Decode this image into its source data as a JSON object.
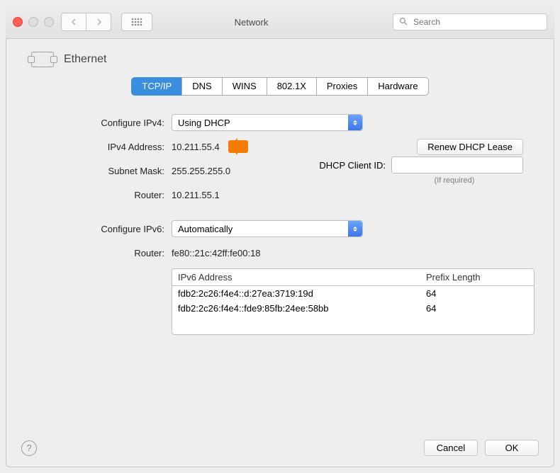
{
  "window": {
    "title": "Network"
  },
  "toolbar": {
    "search_placeholder": "Search"
  },
  "header": {
    "interface": "Ethernet"
  },
  "tabs": [
    "TCP/IP",
    "DNS",
    "WINS",
    "802.1X",
    "Proxies",
    "Hardware"
  ],
  "active_tab_index": 0,
  "ipv4": {
    "configure_label": "Configure IPv4:",
    "configure_value": "Using DHCP",
    "addr_label": "IPv4 Address:",
    "addr_value": "10.211.55.4",
    "mask_label": "Subnet Mask:",
    "mask_value": "255.255.255.0",
    "router_label": "Router:",
    "router_value": "10.211.55.1",
    "renew_button": "Renew DHCP Lease",
    "dhcp_client_label": "DHCP Client ID:",
    "dhcp_client_value": "",
    "dhcp_hint": "(If required)"
  },
  "ipv6": {
    "configure_label": "Configure IPv6:",
    "configure_value": "Automatically",
    "router_label": "Router:",
    "router_value": "fe80::21c:42ff:fe00:18",
    "table_headers": {
      "addr": "IPv6 Address",
      "prefix": "Prefix Length"
    },
    "rows": [
      {
        "addr": "fdb2:2c26:f4e4::d:27ea:3719:19d",
        "prefix": "64"
      },
      {
        "addr": "fdb2:2c26:f4e4::fde9:85fb:24ee:58bb",
        "prefix": "64"
      }
    ]
  },
  "footer": {
    "cancel": "Cancel",
    "ok": "OK"
  }
}
